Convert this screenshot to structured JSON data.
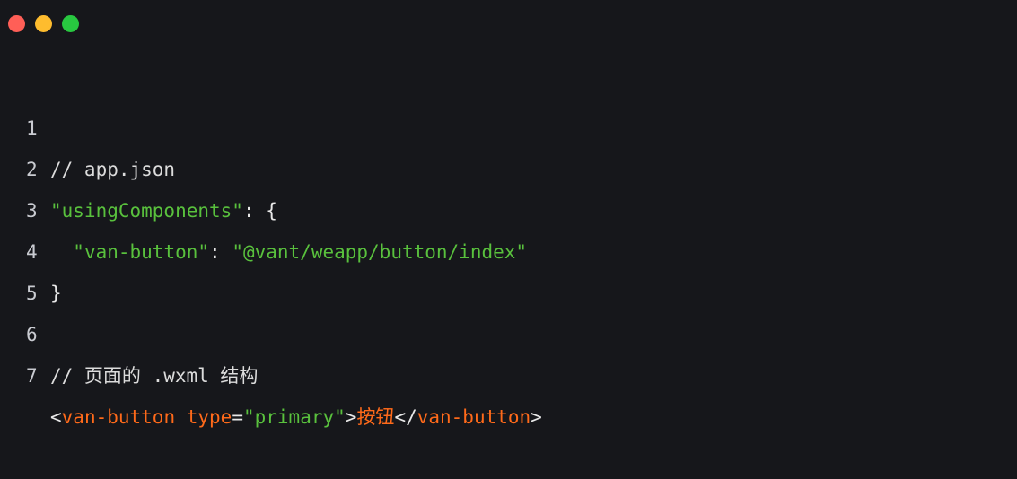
{
  "window": {
    "controls": [
      {
        "name": "close",
        "color": "#ff5f57"
      },
      {
        "name": "minimize",
        "color": "#febc2e"
      },
      {
        "name": "maximize",
        "color": "#28c840"
      }
    ]
  },
  "colors": {
    "background": "#16171b",
    "string": "#59c13d",
    "tag": "#ff6a1a",
    "comment": "#dcdcdc",
    "line_number": "#c9cbd1"
  },
  "code": {
    "lines": [
      {
        "number": "1",
        "comment": "// app.json"
      },
      {
        "number": "2",
        "key": "\"usingComponents\"",
        "sep": ": ",
        "brace": "{"
      },
      {
        "number": "3",
        "indent": "  ",
        "key": "\"van-button\"",
        "sep": ": ",
        "value": "\"@vant/weapp/button/index\""
      },
      {
        "number": "4",
        "brace": "}"
      },
      {
        "number": "5"
      },
      {
        "number": "6",
        "comment": "// 页面的 .wxml 结构"
      },
      {
        "number": "7",
        "open_lt": "<",
        "tag_open": "van-button",
        "space": " ",
        "attr_name": "type",
        "eq": "=",
        "attr_value": "\"primary\"",
        "open_gt": ">",
        "inner_text": "按钮",
        "close_lt": "</",
        "tag_close": "van-button",
        "close_gt": ">"
      }
    ]
  }
}
